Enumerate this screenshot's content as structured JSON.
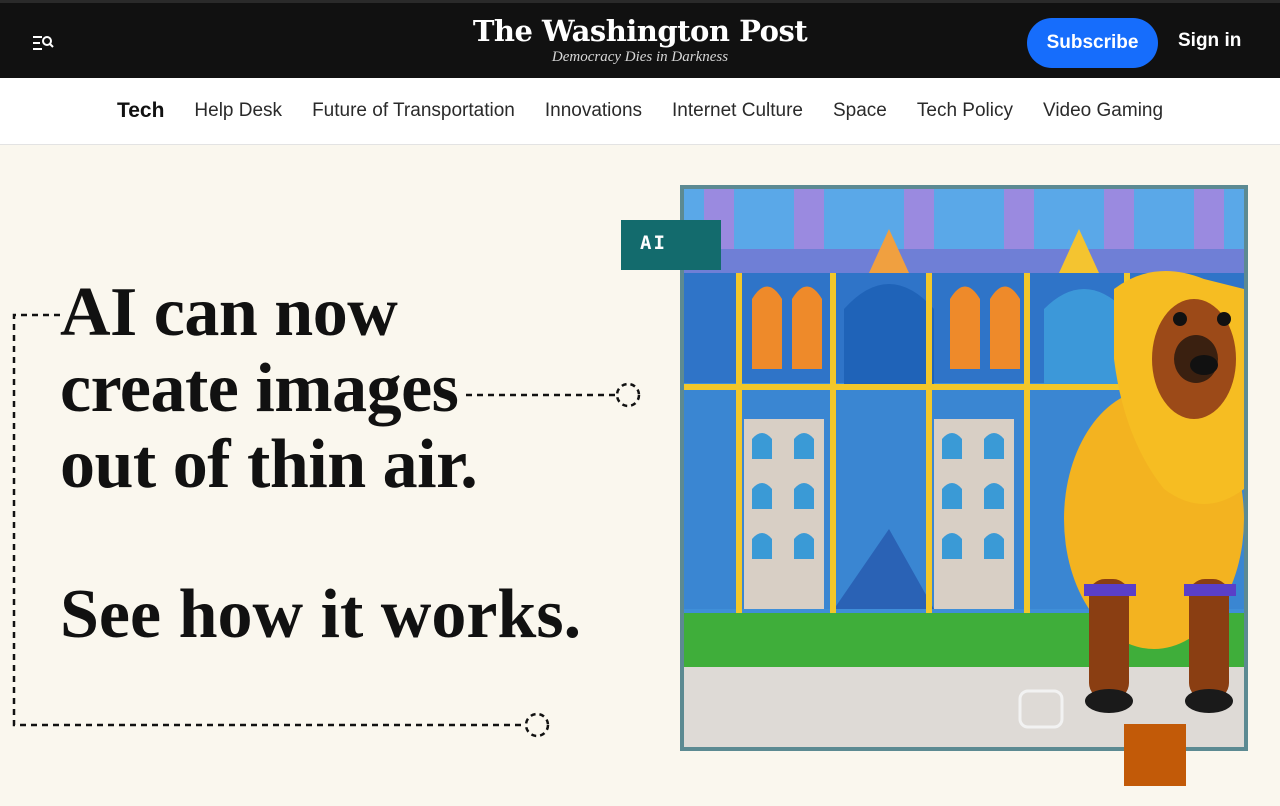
{
  "header": {
    "logo": "The Washington Post",
    "tagline": "Democracy Dies in Darkness",
    "subscribe_label": "Subscribe",
    "signin_label": "Sign in",
    "menu_icon": "menu-search-icon"
  },
  "section_nav": {
    "current": "Tech",
    "items": [
      "Help Desk",
      "Future of Transportation",
      "Innovations",
      "Internet Culture",
      "Space",
      "Tech Policy",
      "Video Gaming"
    ]
  },
  "hero": {
    "headline_lines": [
      "AI can now",
      "create images",
      "out of thin air."
    ],
    "subhead": "See how it works.",
    "tag": "AI"
  },
  "colors": {
    "topbar": "#111111",
    "subscribe": "#166dfc",
    "hero_background": "#faf7ee",
    "tag_background": "#136b6d",
    "accent_orange": "#c25a08",
    "frame_border": "#5c8a92"
  }
}
